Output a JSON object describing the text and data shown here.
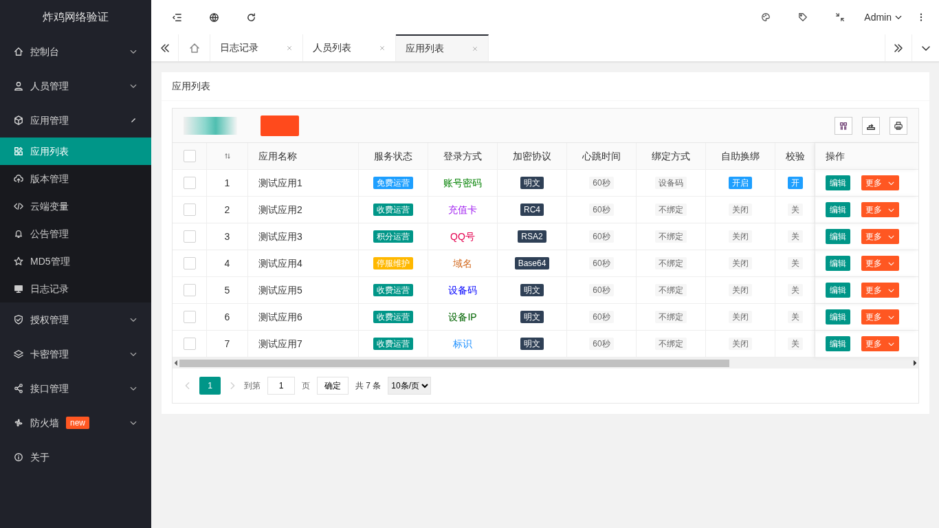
{
  "app_title": "炸鸡网络验证",
  "header": {
    "user": "Admin"
  },
  "tabs": [
    {
      "label": "日志记录",
      "selected": false
    },
    {
      "label": "人员列表",
      "selected": false
    },
    {
      "label": "应用列表",
      "selected": true
    }
  ],
  "sidebar": {
    "items": [
      {
        "label": "控制台",
        "expanded": false
      },
      {
        "label": "人员管理",
        "expanded": false
      },
      {
        "label": "应用管理",
        "expanded": true,
        "children": [
          {
            "label": "应用列表",
            "selected": true
          },
          {
            "label": "版本管理",
            "selected": false
          },
          {
            "label": "云端变量",
            "selected": false
          },
          {
            "label": "公告管理",
            "selected": false
          },
          {
            "label": "MD5管理",
            "selected": false
          },
          {
            "label": "日志记录",
            "selected": false
          }
        ]
      },
      {
        "label": "授权管理",
        "expanded": false
      },
      {
        "label": "卡密管理",
        "expanded": false
      },
      {
        "label": "接口管理",
        "expanded": false
      },
      {
        "label": "防火墙",
        "expanded": false,
        "badge": "new"
      },
      {
        "label": "关于"
      }
    ]
  },
  "card": {
    "title": "应用列表"
  },
  "table": {
    "columns": [
      "应用名称",
      "服务状态",
      "登录方式",
      "加密协议",
      "心跳时间",
      "绑定方式",
      "自助换绑",
      "校验",
      "操作"
    ],
    "header_checked": false,
    "rows": [
      {
        "checked": false,
        "no": "1",
        "name": "测试应用1",
        "status": {
          "text": "免费运营",
          "color": "#1e9fff"
        },
        "login": {
          "text": "账号密码",
          "color": "#008000"
        },
        "protocol": "明文",
        "heartbeat": "60秒",
        "bind": "设备码",
        "auto": {
          "text": "开启",
          "on": true
        },
        "verify": {
          "text": "开",
          "on": true
        },
        "edit": "编辑",
        "more": "更多"
      },
      {
        "checked": false,
        "no": "2",
        "name": "测试应用2",
        "status": {
          "text": "收费运营",
          "color": "#009688"
        },
        "login": {
          "text": "充值卡",
          "color": "#a020f0"
        },
        "protocol": "RC4",
        "heartbeat": "60秒",
        "bind": "不绑定",
        "auto": {
          "text": "关闭",
          "on": false
        },
        "verify": {
          "text": "关",
          "on": false
        },
        "edit": "编辑",
        "more": "更多"
      },
      {
        "checked": false,
        "no": "3",
        "name": "测试应用3",
        "status": {
          "text": "积分运营",
          "color": "#009688"
        },
        "login": {
          "text": "QQ号",
          "color": "#e4004f"
        },
        "protocol": "RSA2",
        "heartbeat": "60秒",
        "bind": "不绑定",
        "auto": {
          "text": "关闭",
          "on": false
        },
        "verify": {
          "text": "关",
          "on": false
        },
        "edit": "编辑",
        "more": "更多"
      },
      {
        "checked": false,
        "no": "4",
        "name": "测试应用4",
        "status": {
          "text": "停服维护",
          "color": "#ffb800"
        },
        "login": {
          "text": "域名",
          "color": "#d2691e"
        },
        "protocol": "Base64",
        "heartbeat": "60秒",
        "bind": "不绑定",
        "auto": {
          "text": "关闭",
          "on": false
        },
        "verify": {
          "text": "关",
          "on": false
        },
        "edit": "编辑",
        "more": "更多"
      },
      {
        "checked": false,
        "no": "5",
        "name": "测试应用5",
        "status": {
          "text": "收费运营",
          "color": "#009688"
        },
        "login": {
          "text": "设备码",
          "color": "#0000ff"
        },
        "protocol": "明文",
        "heartbeat": "60秒",
        "bind": "不绑定",
        "auto": {
          "text": "关闭",
          "on": false
        },
        "verify": {
          "text": "关",
          "on": false
        },
        "edit": "编辑",
        "more": "更多"
      },
      {
        "checked": false,
        "no": "6",
        "name": "测试应用6",
        "status": {
          "text": "收费运营",
          "color": "#009688"
        },
        "login": {
          "text": "设备IP",
          "color": "#006400"
        },
        "protocol": "明文",
        "heartbeat": "60秒",
        "bind": "不绑定",
        "auto": {
          "text": "关闭",
          "on": false
        },
        "verify": {
          "text": "关",
          "on": false
        },
        "edit": "编辑",
        "more": "更多"
      },
      {
        "checked": false,
        "no": "7",
        "name": "测试应用7",
        "status": {
          "text": "收费运营",
          "color": "#009688"
        },
        "login": {
          "text": "标识",
          "color": "#1e90ff"
        },
        "protocol": "明文",
        "heartbeat": "60秒",
        "bind": "不绑定",
        "auto": {
          "text": "关闭",
          "on": false
        },
        "verify": {
          "text": "关",
          "on": false
        },
        "edit": "编辑",
        "more": "更多"
      }
    ]
  },
  "pagination": {
    "current": "1",
    "goto_label": "到第",
    "page_input": "1",
    "page_unit": "页",
    "confirm": "确定",
    "total": "共 7 条",
    "page_size": "10条/页"
  }
}
